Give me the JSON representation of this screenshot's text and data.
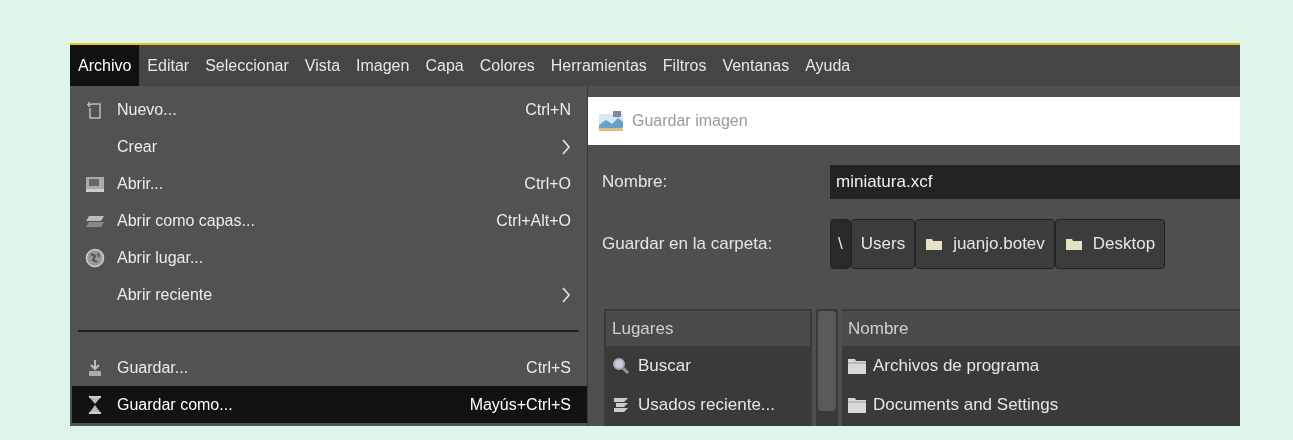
{
  "menubar": [
    {
      "label": "Archivo",
      "selected": true
    },
    {
      "label": "Editar",
      "selected": false
    },
    {
      "label": "Seleccionar",
      "selected": false
    },
    {
      "label": "Vista",
      "selected": false
    },
    {
      "label": "Imagen",
      "selected": false
    },
    {
      "label": "Capa",
      "selected": false
    },
    {
      "label": "Colores",
      "selected": false
    },
    {
      "label": "Herramientas",
      "selected": false
    },
    {
      "label": "Filtros",
      "selected": false
    },
    {
      "label": "Ventanas",
      "selected": false
    },
    {
      "label": "Ayuda",
      "selected": false
    }
  ],
  "file_menu": [
    {
      "kind": "item",
      "label": "Nuevo...",
      "shortcut": "Ctrl+N",
      "submenu": false,
      "selected": false
    },
    {
      "kind": "item",
      "label": "Crear",
      "submenu": true,
      "selected": false
    },
    {
      "kind": "item",
      "label": "Abrir...",
      "shortcut": "Ctrl+O",
      "submenu": false,
      "selected": false
    },
    {
      "kind": "item",
      "label": "Abrir como capas...",
      "shortcut": "Ctrl+Alt+O",
      "submenu": false,
      "selected": false
    },
    {
      "kind": "item",
      "label": "Abrir lugar...",
      "submenu": false,
      "selected": false
    },
    {
      "kind": "item",
      "label": "Abrir reciente",
      "submenu": true,
      "selected": false
    },
    {
      "kind": "separator"
    },
    {
      "kind": "item",
      "label": "Guardar...",
      "shortcut": "Ctrl+S",
      "submenu": false,
      "selected": false
    },
    {
      "kind": "item",
      "label": "Guardar como...",
      "shortcut": "Mayús+Ctrl+S",
      "submenu": false,
      "selected": true
    }
  ],
  "dialog": {
    "title": "Guardar imagen",
    "name_label": "Nombre:",
    "name_value": "miniatura.xcf",
    "folder_label": "Guardar en la carpeta:",
    "path": [
      {
        "kind": "root",
        "label": "\\"
      },
      {
        "kind": "plain",
        "label": "Users"
      },
      {
        "kind": "folder",
        "label": "juanjo.botev"
      },
      {
        "kind": "folder",
        "label": "Desktop"
      }
    ],
    "places_header": "Lugares",
    "places": [
      "Buscar",
      "Usados reciente..."
    ],
    "files_header": "Nombre",
    "files": [
      "Archivos de programa",
      "Documents and Settings"
    ]
  }
}
